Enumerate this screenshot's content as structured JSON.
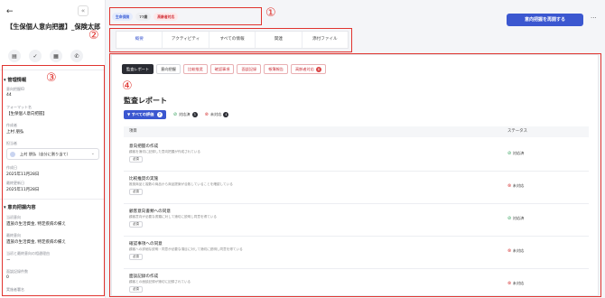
{
  "left": {
    "back_icon": "arrow-left-icon",
    "collapse_icon": "chevrons-left-icon",
    "title": "【生保個人意向把握】_保険太郎",
    "actions": [
      {
        "icon": "chat-icon",
        "glyph": "▤"
      },
      {
        "icon": "check-icon",
        "glyph": "✓"
      },
      {
        "icon": "calendar-icon",
        "glyph": "▦"
      },
      {
        "icon": "phone-icon",
        "glyph": "✆"
      }
    ],
    "section1_title": "管理情報",
    "fields": [
      {
        "label": "意向把握ID",
        "value": "44"
      },
      {
        "label": "フォーマット名",
        "value": "【生保個人意向把握】"
      },
      {
        "label": "作成者",
        "value": "上村 朋弘"
      },
      {
        "label": "担当者",
        "value": ""
      },
      {
        "label": "作成日",
        "value": "2025年11月28日"
      },
      {
        "label": "最終更新日",
        "value": "2025年11月28日"
      }
    ],
    "owner_value": "上村 朋弘（自分に割り当て）",
    "section2_title": "意向把握内容",
    "fields2": [
      {
        "label": "当初意向",
        "value": "遺族の生活資金, 特定疾病の備え"
      },
      {
        "label": "最終意向",
        "value": "遺族の生活資金, 特定疾病の備え"
      },
      {
        "label": "当初と最終意向の相違理由",
        "value": "ー"
      },
      {
        "label": "面談記録件数",
        "value": "0"
      },
      {
        "label": "実施者署名",
        "value": ""
      }
    ]
  },
  "header": {
    "tags": [
      "生命保険",
      "77歳",
      "高齢者対応"
    ],
    "reexec_label": "意向把握を再開する",
    "more_icon": "more-horizontal-icon"
  },
  "tabs": [
    "概要",
    "アクティビティ",
    "すべての情報",
    "関連",
    "添付ファイル"
  ],
  "active_tab": 0,
  "subtabs": [
    {
      "label": "監査レポート",
      "style": "active"
    },
    {
      "label": "意向把握",
      "style": "normal"
    },
    {
      "label": "比較推奨",
      "style": "pink"
    },
    {
      "label": "確認事項",
      "style": "pink"
    },
    {
      "label": "面談記録",
      "style": "pink"
    },
    {
      "label": "帳簿報告",
      "style": "pink"
    },
    {
      "label": "高齢者対応",
      "style": "pink",
      "count": "8"
    }
  ],
  "audit": {
    "title": "監査レポート",
    "filter_all": "すべての評価",
    "filter_all_count": "7",
    "filter_ok": "対応済",
    "filter_ok_count": "3",
    "filter_ng": "未対応",
    "filter_ng_count": "4",
    "col_item": "項目",
    "col_status": "ステータス",
    "rows": [
      {
        "title": "意向把握の作成",
        "desc": "顧客を適切に記録した意向把握が作成されている",
        "badge": "必須",
        "status": "対応済",
        "ok": true
      },
      {
        "title": "比較推奨の実施",
        "desc": "推奨商品と複数の商品から商品提案が合致していることを確認している",
        "badge": "必須",
        "status": "未対応",
        "ok": false
      },
      {
        "title": "顧客意向書類への同意",
        "desc": "顧客意向が必要な書類に対して適切に説明し同意を得ている",
        "badge": "必須",
        "status": "対応済",
        "ok": true
      },
      {
        "title": "確認事項への同意",
        "desc": "顧客への詳細な説明・同意が必要な項目に対して適切に説明し同意を得ている",
        "badge": "必須",
        "status": "未対応",
        "ok": false
      },
      {
        "title": "面談記録の作成",
        "desc": "顧客との面談記録が適切に記録されている",
        "badge": "必須",
        "status": "未対応",
        "ok": false
      }
    ]
  },
  "annotations": [
    "①",
    "②",
    "③",
    "④"
  ],
  "colors": {
    "accent": "#3b57d0",
    "annotation": "#e0342f",
    "ok": "#2f9e58",
    "ng": "#d94545"
  }
}
